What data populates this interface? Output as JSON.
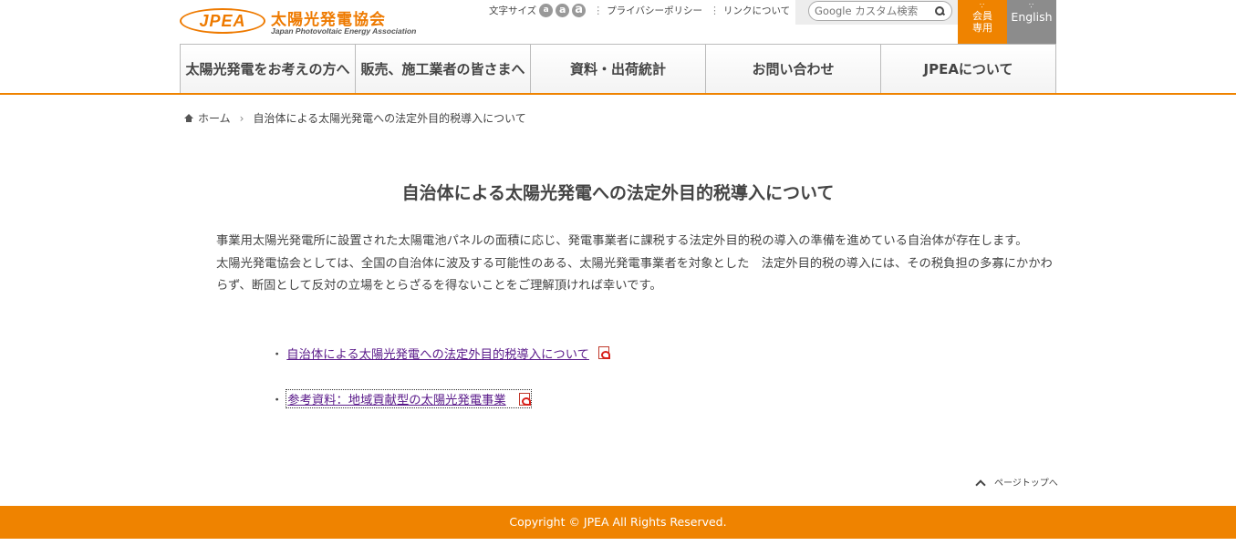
{
  "header": {
    "logo_text": "JPEA",
    "logo_jp": "太陽光発電協会",
    "logo_en": "Japan Photovoltaic Energy Association",
    "font_size_label": "文字サイズ",
    "font_size_small": "a",
    "font_size_medium": "a",
    "font_size_large": "a",
    "privacy_policy": "プライバシーポリシー",
    "links": "リンクについて",
    "search_placeholder": "Google カスタム検索",
    "member_line1": "会員",
    "member_line2": "専用",
    "english": "English",
    "brand_color": "#ef8300"
  },
  "nav": {
    "items": [
      {
        "label": "太陽光発電をお考えの方へ"
      },
      {
        "label": "販売、施工業者の皆さまへ"
      },
      {
        "label": "資料・出荷統計"
      },
      {
        "label": "お問い合わせ"
      },
      {
        "label": "JPEAについて"
      }
    ]
  },
  "breadcrumb": {
    "home": "ホーム",
    "separator": "›",
    "current": "自治体による太陽光発電への法定外目的税導入について"
  },
  "main": {
    "title": "自治体による太陽光発電への法定外目的税導入について",
    "paragraph1": "事業用太陽光発電所に設置された太陽電池パネルの面積に応じ、発電事業者に課税する法定外目的税の導入の準備を進めている自治体が存在します。",
    "paragraph2": "太陽光発電協会としては、全国の自治体に波及する可能性のある、太陽光発電事業者を対象とした　法定外目的税の導入には、その税負担の多寡にかかわらず、断固として反対の立場をとらざるを得ないことをご理解頂ければ幸いです。",
    "bullet": "・",
    "links": [
      {
        "label": "自治体による太陽光発電への法定外目的税導入について",
        "icon": "pdf-icon"
      },
      {
        "label": "参考資料：地域貢献型の太陽光発電事業",
        "icon": "pdf-icon"
      }
    ]
  },
  "pagetop": "ページトップへ",
  "footer": {
    "copyright": "Copyright © JPEA All Rights Reserved."
  }
}
